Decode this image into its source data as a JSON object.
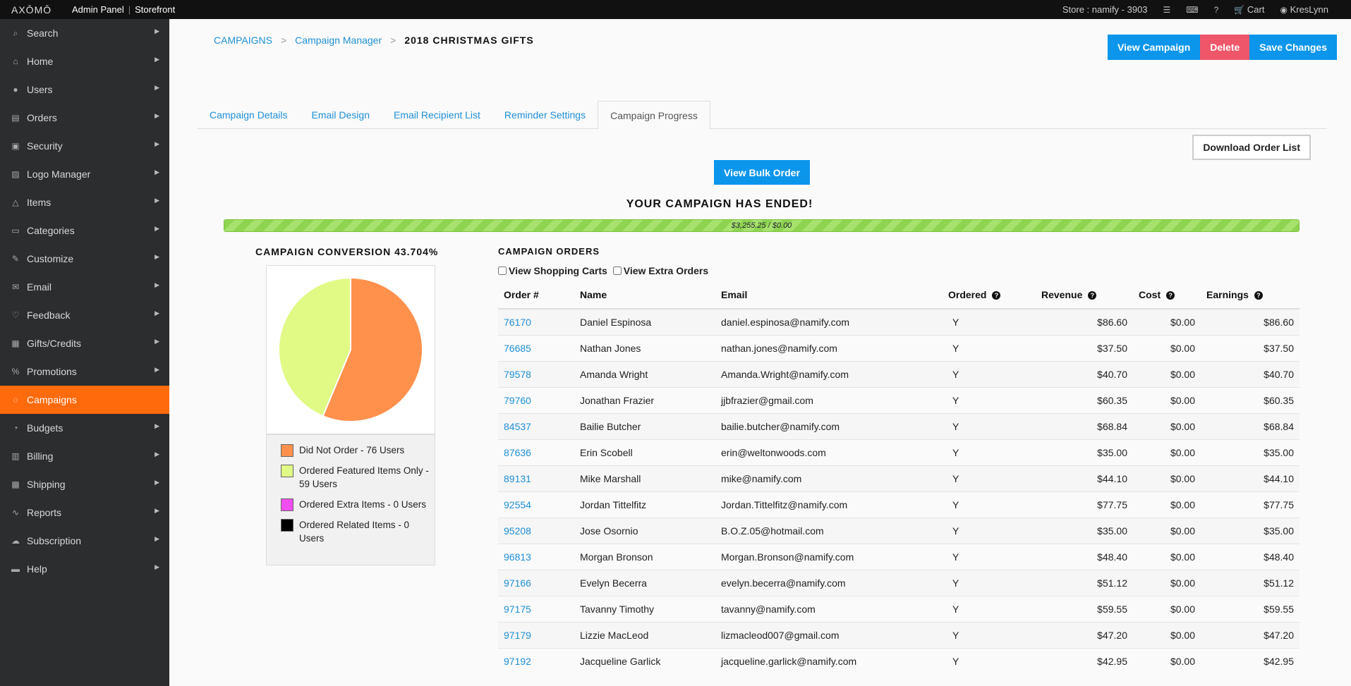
{
  "topbar": {
    "logo": "AXŌMŌ",
    "admin_panel": "Admin Panel",
    "separator": "|",
    "storefront": "Storefront",
    "store": "Store : namify - 3903",
    "cart": "Cart",
    "user": "KresLynn"
  },
  "sidebar": {
    "items": [
      {
        "label": "Search",
        "icon": "search-icon",
        "glyph": "⌕"
      },
      {
        "label": "Home",
        "icon": "home-icon",
        "glyph": "⌂"
      },
      {
        "label": "Users",
        "icon": "user-icon",
        "glyph": "●"
      },
      {
        "label": "Orders",
        "icon": "clipboard-icon",
        "glyph": "▤"
      },
      {
        "label": "Security",
        "icon": "lock-icon",
        "glyph": "▣"
      },
      {
        "label": "Logo Manager",
        "icon": "image-icon",
        "glyph": "▨"
      },
      {
        "label": "Items",
        "icon": "hanger-icon",
        "glyph": "△"
      },
      {
        "label": "Categories",
        "icon": "folder-icon",
        "glyph": "▭"
      },
      {
        "label": "Customize",
        "icon": "pencil-icon",
        "glyph": "✎"
      },
      {
        "label": "Email",
        "icon": "envelope-icon",
        "glyph": "✉"
      },
      {
        "label": "Feedback",
        "icon": "heart-icon",
        "glyph": "♡"
      },
      {
        "label": "Gifts/Credits",
        "icon": "gift-icon",
        "glyph": "▦"
      },
      {
        "label": "Promotions",
        "icon": "percent-icon",
        "glyph": "%"
      },
      {
        "label": "Campaigns",
        "icon": "chat-icon",
        "glyph": "◌"
      },
      {
        "label": "Budgets",
        "icon": "piechart-icon",
        "glyph": "◔"
      },
      {
        "label": "Billing",
        "icon": "invoice-icon",
        "glyph": "▥"
      },
      {
        "label": "Shipping",
        "icon": "box-icon",
        "glyph": "▩"
      },
      {
        "label": "Reports",
        "icon": "linechart-icon",
        "glyph": "∿"
      },
      {
        "label": "Subscription",
        "icon": "cloud-icon",
        "glyph": "☁"
      },
      {
        "label": "Help",
        "icon": "speech-icon",
        "glyph": "▬"
      }
    ],
    "active_index": 13
  },
  "breadcrumb": {
    "level1": "CAMPAIGNS",
    "level2": "Campaign Manager",
    "current": "2018 CHRISTMAS GIFTS",
    "chevron": ">"
  },
  "actions": {
    "view_campaign": "View Campaign",
    "delete": "Delete",
    "save_changes": "Save Changes"
  },
  "tabs": [
    "Campaign Details",
    "Email Design",
    "Email Recipient List",
    "Reminder Settings",
    "Campaign Progress"
  ],
  "active_tab": 4,
  "download_label": "Download Order List",
  "bulk_order_label": "View Bulk Order",
  "ended_message": "YOUR CAMPAIGN HAS ENDED!",
  "progress": {
    "text": "$3,255.25 / $0.00",
    "fraction": 1.0
  },
  "conversion": {
    "title": "CAMPAIGN CONVERSION 43.704%",
    "legend": [
      {
        "label": "Did Not Order - 76 Users",
        "color": "#ff914d"
      },
      {
        "label": "Ordered Featured Items Only - 59 Users",
        "color": "#e0fa85"
      },
      {
        "label": "Ordered Extra Items - 0 Users",
        "color": "#f04ef0"
      },
      {
        "label": "Ordered Related Items - 0 Users",
        "color": "#000000"
      }
    ]
  },
  "chart_data": {
    "type": "pie",
    "categories": [
      "Did Not Order",
      "Ordered Featured Items Only",
      "Ordered Extra Items",
      "Ordered Related Items"
    ],
    "values": [
      76,
      59,
      0,
      0
    ],
    "colors": [
      "#ff914d",
      "#e0fa85",
      "#f04ef0",
      "#000000"
    ]
  },
  "orders": {
    "title": "CAMPAIGN ORDERS",
    "view_carts": "View Shopping Carts",
    "view_extra": "View Extra Orders",
    "columns": {
      "order": "Order #",
      "name": "Name",
      "email": "Email",
      "ordered": "Ordered",
      "revenue": "Revenue",
      "cost": "Cost",
      "earnings": "Earnings"
    },
    "rows": [
      {
        "order": "76170",
        "name": "Daniel Espinosa",
        "email": "daniel.espinosa@namify.com",
        "ordered": "Y",
        "revenue": "$86.60",
        "cost": "$0.00",
        "earnings": "$86.60"
      },
      {
        "order": "76685",
        "name": "Nathan Jones",
        "email": "nathan.jones@namify.com",
        "ordered": "Y",
        "revenue": "$37.50",
        "cost": "$0.00",
        "earnings": "$37.50"
      },
      {
        "order": "79578",
        "name": "Amanda Wright",
        "email": "Amanda.Wright@namify.com",
        "ordered": "Y",
        "revenue": "$40.70",
        "cost": "$0.00",
        "earnings": "$40.70"
      },
      {
        "order": "79760",
        "name": "Jonathan Frazier",
        "email": "jjbfrazier@gmail.com",
        "ordered": "Y",
        "revenue": "$60.35",
        "cost": "$0.00",
        "earnings": "$60.35"
      },
      {
        "order": "84537",
        "name": "Bailie Butcher",
        "email": "bailie.butcher@namify.com",
        "ordered": "Y",
        "revenue": "$68.84",
        "cost": "$0.00",
        "earnings": "$68.84"
      },
      {
        "order": "87636",
        "name": "Erin Scobell",
        "email": "erin@weltonwoods.com",
        "ordered": "Y",
        "revenue": "$35.00",
        "cost": "$0.00",
        "earnings": "$35.00"
      },
      {
        "order": "89131",
        "name": "Mike Marshall",
        "email": "mike@namify.com",
        "ordered": "Y",
        "revenue": "$44.10",
        "cost": "$0.00",
        "earnings": "$44.10"
      },
      {
        "order": "92554",
        "name": "Jordan Tittelfitz",
        "email": "Jordan.Tittelfitz@namify.com",
        "ordered": "Y",
        "revenue": "$77.75",
        "cost": "$0.00",
        "earnings": "$77.75"
      },
      {
        "order": "95208",
        "name": "Jose Osornio",
        "email": "B.O.Z.05@hotmail.com",
        "ordered": "Y",
        "revenue": "$35.00",
        "cost": "$0.00",
        "earnings": "$35.00"
      },
      {
        "order": "96813",
        "name": "Morgan Bronson",
        "email": "Morgan.Bronson@namify.com",
        "ordered": "Y",
        "revenue": "$48.40",
        "cost": "$0.00",
        "earnings": "$48.40"
      },
      {
        "order": "97166",
        "name": "Evelyn Becerra",
        "email": "evelyn.becerra@namify.com",
        "ordered": "Y",
        "revenue": "$51.12",
        "cost": "$0.00",
        "earnings": "$51.12"
      },
      {
        "order": "97175",
        "name": "Tavanny Timothy",
        "email": "tavanny@namify.com",
        "ordered": "Y",
        "revenue": "$59.55",
        "cost": "$0.00",
        "earnings": "$59.55"
      },
      {
        "order": "97179",
        "name": "Lizzie MacLeod",
        "email": "lizmacleod007@gmail.com",
        "ordered": "Y",
        "revenue": "$47.20",
        "cost": "$0.00",
        "earnings": "$47.20"
      },
      {
        "order": "97192",
        "name": "Jacqueline Garlick",
        "email": "jacqueline.garlick@namify.com",
        "ordered": "Y",
        "revenue": "$42.95",
        "cost": "$0.00",
        "earnings": "$42.95"
      }
    ]
  }
}
